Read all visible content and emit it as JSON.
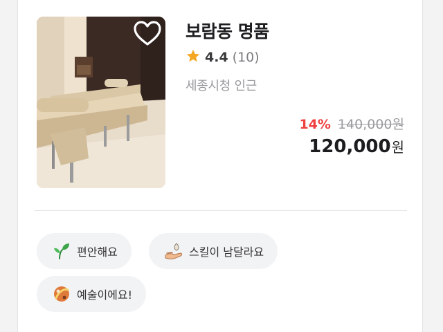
{
  "listing": {
    "title": "보람동 명품",
    "rating": "4.4",
    "review_count": "(10)",
    "location": "세종시청 인근",
    "discount": "14%",
    "original_price": "140,000원",
    "price_value": "120,000",
    "price_unit": "원",
    "favorited": false
  },
  "tags": [
    {
      "label": "편안해요",
      "icon": "sprout-icon"
    },
    {
      "label": "스킬이 남달라요",
      "icon": "hand-skill-icon"
    },
    {
      "label": "예술이에요!",
      "icon": "art-icon"
    }
  ],
  "colors": {
    "star": "#f5a623",
    "discount": "#ef4040",
    "tag_bg": "#f2f3f5"
  }
}
